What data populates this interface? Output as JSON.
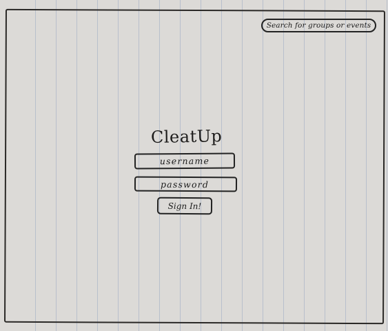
{
  "search": {
    "placeholder": "Search for groups or events"
  },
  "app": {
    "title": "CleatUp"
  },
  "login": {
    "username_placeholder": "username",
    "password_placeholder": "password",
    "signin_label": "Sign In!"
  }
}
